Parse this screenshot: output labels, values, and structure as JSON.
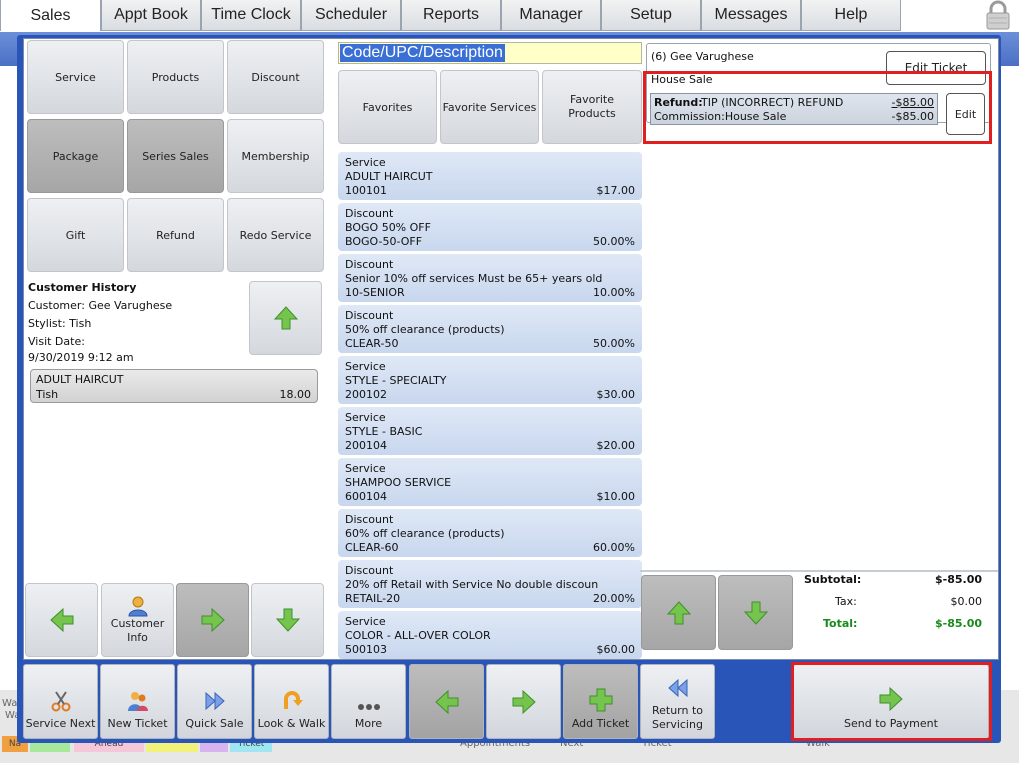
{
  "tabs": [
    "Sales",
    "Appt Book",
    "Time Clock",
    "Scheduler",
    "Reports",
    "Manager",
    "Setup",
    "Messages",
    "Help"
  ],
  "background": {
    "labels": [
      "Wa",
      "Wa",
      "Na",
      "Ahead",
      "Ticket",
      "Appointments",
      "Next",
      "Ticket",
      "Walk"
    ]
  },
  "categories": {
    "service": "Service",
    "products": "Products",
    "discount": "Discount",
    "package": "Package",
    "series_sales": "Series Sales",
    "membership": "Membership",
    "gift": "Gift",
    "refund": "Refund",
    "redo_service": "Redo Service"
  },
  "history": {
    "title": "Customer History",
    "customer": "Customer: Gee Varughese",
    "stylist": "Stylist: Tish",
    "visit_label": "Visit Date:",
    "visit_date": "9/30/2019 9:12 am",
    "entry": {
      "name": "ADULT HAIRCUT",
      "stylist": "Tish",
      "amount": "18.00"
    }
  },
  "left_nav": {
    "customer_info": "Customer Info"
  },
  "search": {
    "label": "Code/UPC/Description"
  },
  "fav": {
    "favorites": "Favorites",
    "favorite_services": "Favorite Services",
    "favorite_products": "Favorite Products"
  },
  "items": [
    {
      "type": "Service",
      "name": "ADULT HAIRCUT",
      "code": "100101",
      "price": "$17.00"
    },
    {
      "type": "Discount",
      "name": "BOGO 50% OFF",
      "code": "BOGO-50-OFF",
      "price": "50.00%"
    },
    {
      "type": "Discount",
      "name": "Senior 10% off services Must be 65+ years old",
      "code": "10-SENIOR",
      "price": "10.00%"
    },
    {
      "type": "Discount",
      "name": "50% off clearance (products)",
      "code": "CLEAR-50",
      "price": "50.00%"
    },
    {
      "type": "Service",
      "name": "STYLE - SPECIALTY",
      "code": "200102",
      "price": "$30.00"
    },
    {
      "type": "Service",
      "name": "STYLE - BASIC",
      "code": "200104",
      "price": "$20.00"
    },
    {
      "type": "Service",
      "name": "SHAMPOO SERVICE",
      "code": "600104",
      "price": "$10.00"
    },
    {
      "type": "Discount",
      "name": "60% off clearance (products)",
      "code": "CLEAR-60",
      "price": "60.00%"
    },
    {
      "type": "Discount",
      "name": "20% off Retail with Service No double discoun",
      "code": "RETAIL-20",
      "price": "20.00%"
    },
    {
      "type": "Service",
      "name": "COLOR - ALL-OVER COLOR",
      "code": "500103",
      "price": "$60.00"
    }
  ],
  "ticket": {
    "header": "(6) Gee Varughese",
    "edit_ticket": "Edit Ticket",
    "house_sale": "House Sale",
    "line": {
      "kind": "Refund:",
      "desc": "TIP (INCORRECT) REFUND",
      "amount": "-$85.00",
      "commission": "Commission:House Sale",
      "commission_amount": "-$85.00"
    },
    "edit": "Edit"
  },
  "totals": {
    "subtotal_label": "Subtotal:",
    "subtotal": "$-85.00",
    "tax_label": "Tax:",
    "tax": "$0.00",
    "total_label": "Total:",
    "total": "$-85.00"
  },
  "bottom": {
    "service_next": "Service Next",
    "new_ticket": "New Ticket",
    "quick_sale": "Quick Sale",
    "look_walk": "Look & Walk",
    "more": "More",
    "add_ticket": "Add Ticket",
    "return_servicing": "Return to Servicing",
    "send_payment": "Send to Payment"
  },
  "colors": {
    "window_blue": "#2a55b8",
    "item_bg": "#d3dff2",
    "highlight_red": "#e02020",
    "total_green": "#1a8a1a",
    "arrow_green": "#6cc04a"
  }
}
